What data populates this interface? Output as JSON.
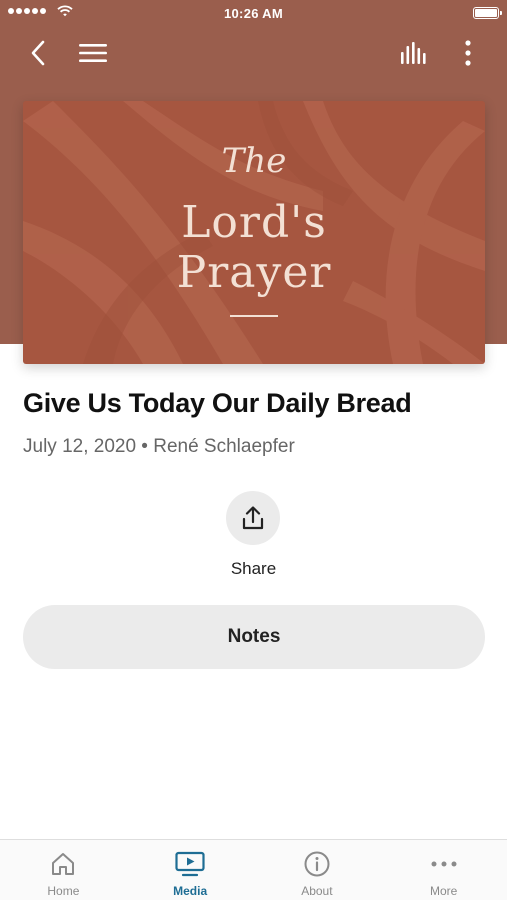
{
  "status_bar": {
    "time": "10:26 AM"
  },
  "artwork": {
    "line_the": "The",
    "line_1": "Lord's",
    "line_2": "Prayer",
    "colors": {
      "header_bg": "#9a5e4d",
      "art_bg": "#a65640",
      "art_text": "#f3e0d4"
    }
  },
  "episode": {
    "title": "Give Us Today Our Daily Bread",
    "meta": "July 12, 2020 • René Schlaepfer"
  },
  "share": {
    "label": "Share"
  },
  "notes": {
    "label": "Notes"
  },
  "tabs": [
    {
      "label": "Home",
      "icon": "home-icon",
      "active": false
    },
    {
      "label": "Media",
      "icon": "media-icon",
      "active": true
    },
    {
      "label": "About",
      "icon": "info-icon",
      "active": false
    },
    {
      "label": "More",
      "icon": "more-dots-icon",
      "active": false
    }
  ],
  "accent_color": "#1e6d94"
}
